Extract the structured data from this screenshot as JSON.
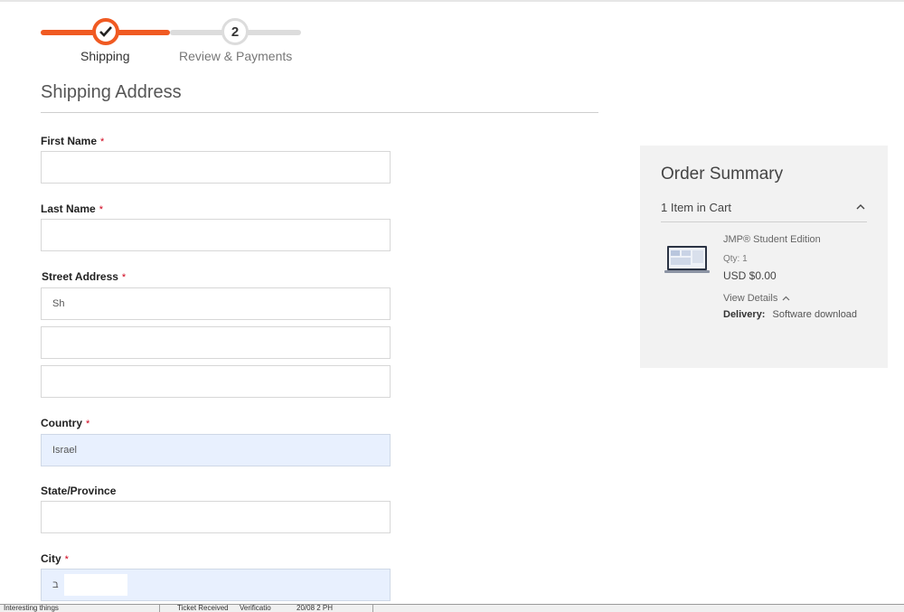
{
  "stepper": {
    "steps": [
      {
        "label": "Shipping",
        "state": "done"
      },
      {
        "number": "2",
        "label": "Review & Payments",
        "state": "todo"
      }
    ],
    "accent": "#f05a22"
  },
  "form": {
    "title": "Shipping Address",
    "required_mark": "*",
    "first_name": {
      "label": "First Name",
      "value": ""
    },
    "last_name": {
      "label": "Last Name",
      "value": ""
    },
    "street": {
      "label": "Street Address",
      "line1": "Sh",
      "line2": "",
      "line3": ""
    },
    "country": {
      "label": "Country",
      "value": "Israel"
    },
    "state": {
      "label": "State/Province",
      "value": ""
    },
    "city": {
      "label": "City",
      "value": "ב"
    }
  },
  "summary": {
    "title": "Order Summary",
    "cart_count": "1 Item in Cart",
    "product": {
      "name": "JMP® Student Edition",
      "qty": "Qty: 1",
      "price": "USD $0.00",
      "view_details": "View Details",
      "delivery_label": "Delivery:",
      "delivery_value": "Software download"
    }
  },
  "taskbar": {
    "items": [
      "Interesting things",
      "Ticket Received",
      "Verificatio",
      "20/08 2 PH"
    ]
  }
}
